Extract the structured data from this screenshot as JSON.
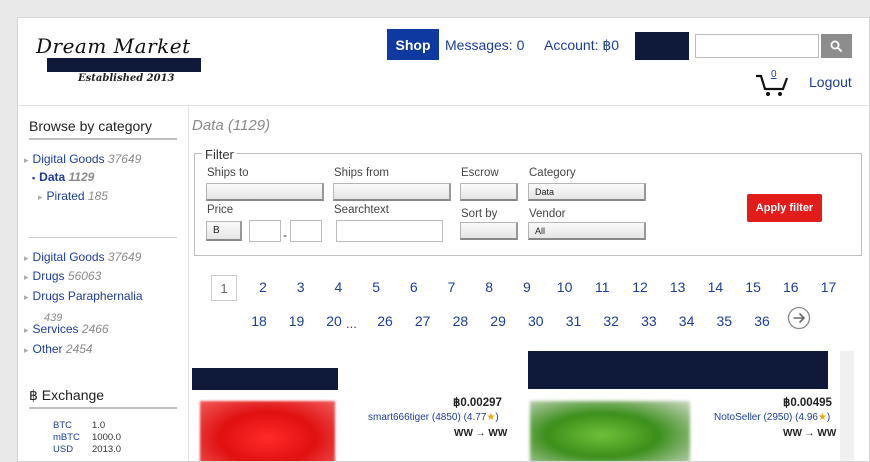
{
  "header": {
    "logo": "Dream Market",
    "tagline": "Established 2013",
    "shop_label": "Shop",
    "messages_label": "Messages: 0",
    "account_label": "Account: ฿0",
    "search_placeholder": "",
    "cart_count": "0",
    "logout_label": "Logout"
  },
  "sidebar": {
    "browse_heading": "Browse by category",
    "tree": [
      {
        "label": "Digital Goods",
        "count": "37649"
      },
      {
        "label": "Data",
        "count": "1129",
        "active": true
      },
      {
        "label": "Pirated",
        "count": "185"
      }
    ],
    "categories": [
      {
        "label": "Digital Goods",
        "count": "37649"
      },
      {
        "label": "Drugs",
        "count": "56063"
      },
      {
        "label": "Drugs Paraphernalia",
        "count": "439"
      },
      {
        "label": "Services",
        "count": "2466"
      },
      {
        "label": "Other",
        "count": "2454"
      }
    ],
    "exchange_heading": "฿ Exchange",
    "exchange": [
      {
        "code": "BTC",
        "value": "1.0"
      },
      {
        "code": "mBTC",
        "value": "1000.0"
      },
      {
        "code": "USD",
        "value": "2013.0"
      }
    ]
  },
  "main": {
    "title": "Data (1129)",
    "filter": {
      "legend": "Filter",
      "ships_to_label": "Ships to",
      "ships_from_label": "Ships from",
      "escrow_label": "Escrow",
      "category_label": "Category",
      "category_value": "Data",
      "price_label": "Price",
      "price_currency": "B",
      "searchtext_label": "Searchtext",
      "sort_by_label": "Sort by",
      "vendor_label": "Vendor",
      "vendor_value": "All",
      "apply_label": "Apply filter"
    },
    "pagination": {
      "current": "1",
      "row1": [
        "2",
        "3",
        "4",
        "5",
        "6",
        "7",
        "8",
        "9",
        "10",
        "11",
        "12",
        "13",
        "14",
        "15",
        "16",
        "17"
      ],
      "row2a": [
        "18",
        "19",
        "20"
      ],
      "ellipsis": "...",
      "row2b": [
        "26",
        "27",
        "28",
        "29",
        "30",
        "31",
        "32",
        "33",
        "34",
        "35",
        "36"
      ]
    },
    "listings": [
      {
        "price": "฿0.00297",
        "seller": "smart666tiger (4850) (4.77",
        "ships": "WW → WW"
      },
      {
        "price": "฿0.00495",
        "seller": "NotoSeller (2950) (4.96",
        "ships": "WW → WW"
      }
    ]
  },
  "colors": {
    "brand_navy": "#0f1a3a",
    "link_blue": "#1b3d9c",
    "apply_red": "#e21b1b",
    "shop_blue": "#0e3aa0"
  }
}
